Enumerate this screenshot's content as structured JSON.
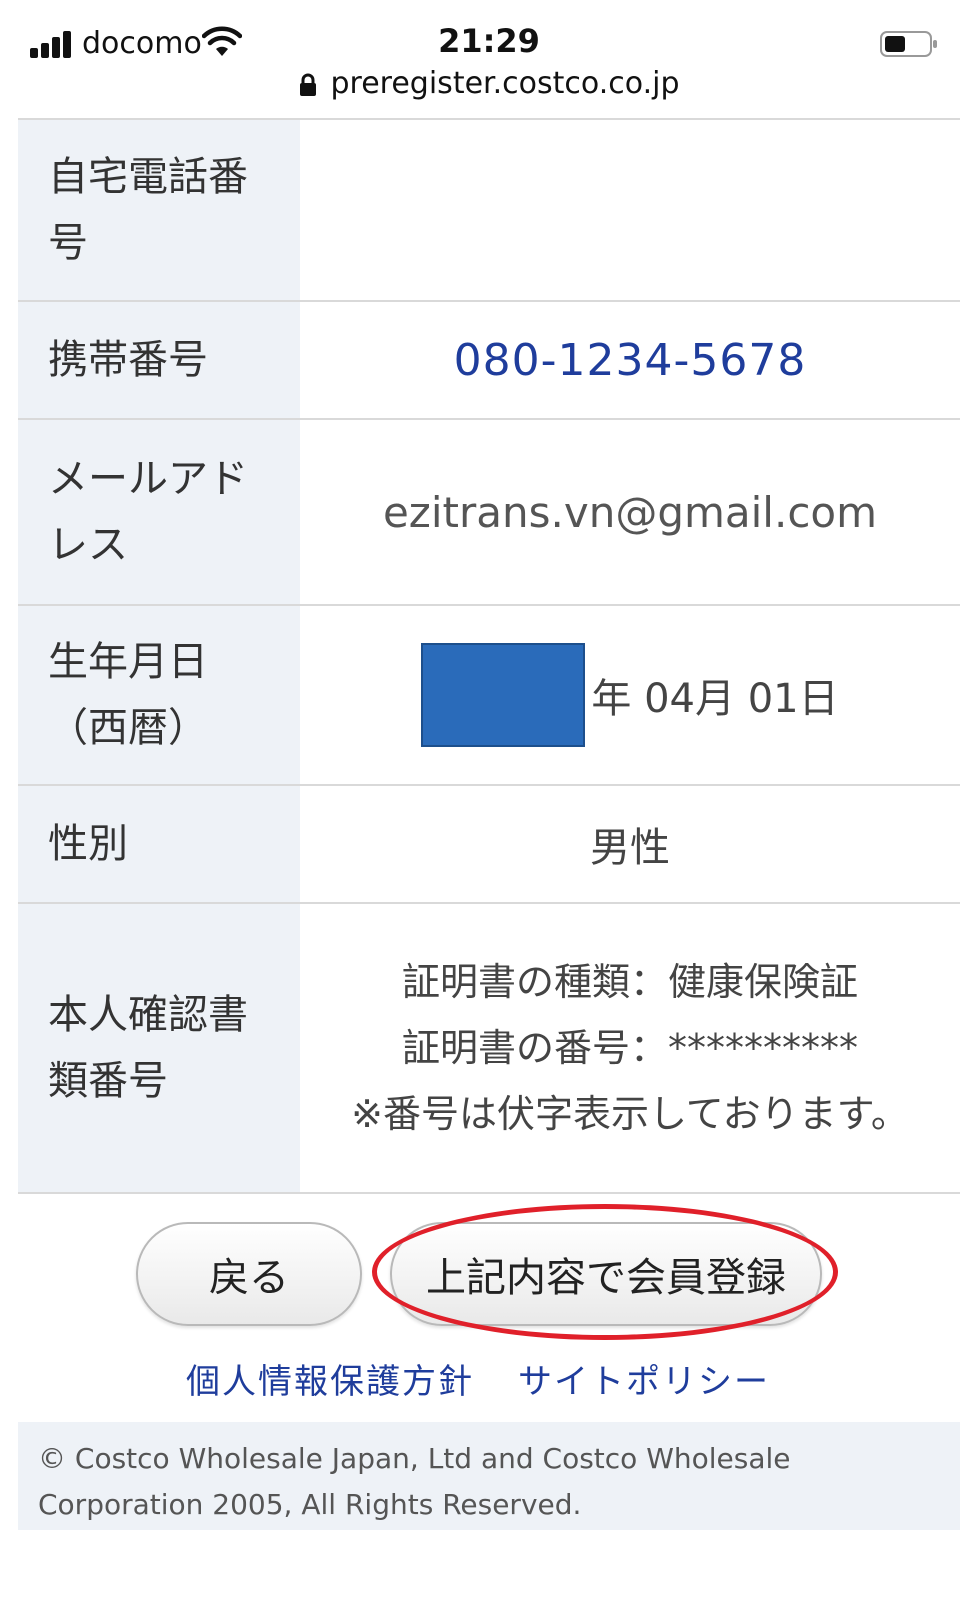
{
  "status_bar": {
    "carrier": "docomo",
    "time": "21:29",
    "url": "preregister.costco.co.jp",
    "signal_icon": "signal-icon",
    "wifi_icon": "wifi-icon",
    "battery_icon": "battery-icon",
    "lock_icon": "lock-icon"
  },
  "rows": {
    "home_phone": {
      "label": "自宅電話番号",
      "value": ""
    },
    "mobile": {
      "label": "携帯番号",
      "value": "080-1234-5678"
    },
    "email": {
      "label": "メールアドレス",
      "value": "ezitrans.vn@gmail.com"
    },
    "birthdate": {
      "label": "生年月日（西暦）",
      "value": "年 04月 01日"
    },
    "gender": {
      "label": "性別",
      "value": "男性"
    },
    "id_doc": {
      "label": "本人確認書類番号",
      "line1": "証明書の種類：健康保険証",
      "line2": "証明書の番号：**********",
      "line3": "※番号は伏字表示しております。"
    }
  },
  "buttons": {
    "back": "戻る",
    "submit": "上記内容で会員登録"
  },
  "links": {
    "privacy": "個人情報保護方針",
    "site_policy": "サイトポリシー"
  },
  "footer": {
    "copyright": "© Costco Wholesale Japan, Ltd and Costco Wholesale Corporation 2005, All Rights Reserved."
  },
  "colors": {
    "label_bg": "#eef2f7",
    "link": "#1f3d9c",
    "redaction": "#2a6bba",
    "highlight": "#e0202a"
  }
}
